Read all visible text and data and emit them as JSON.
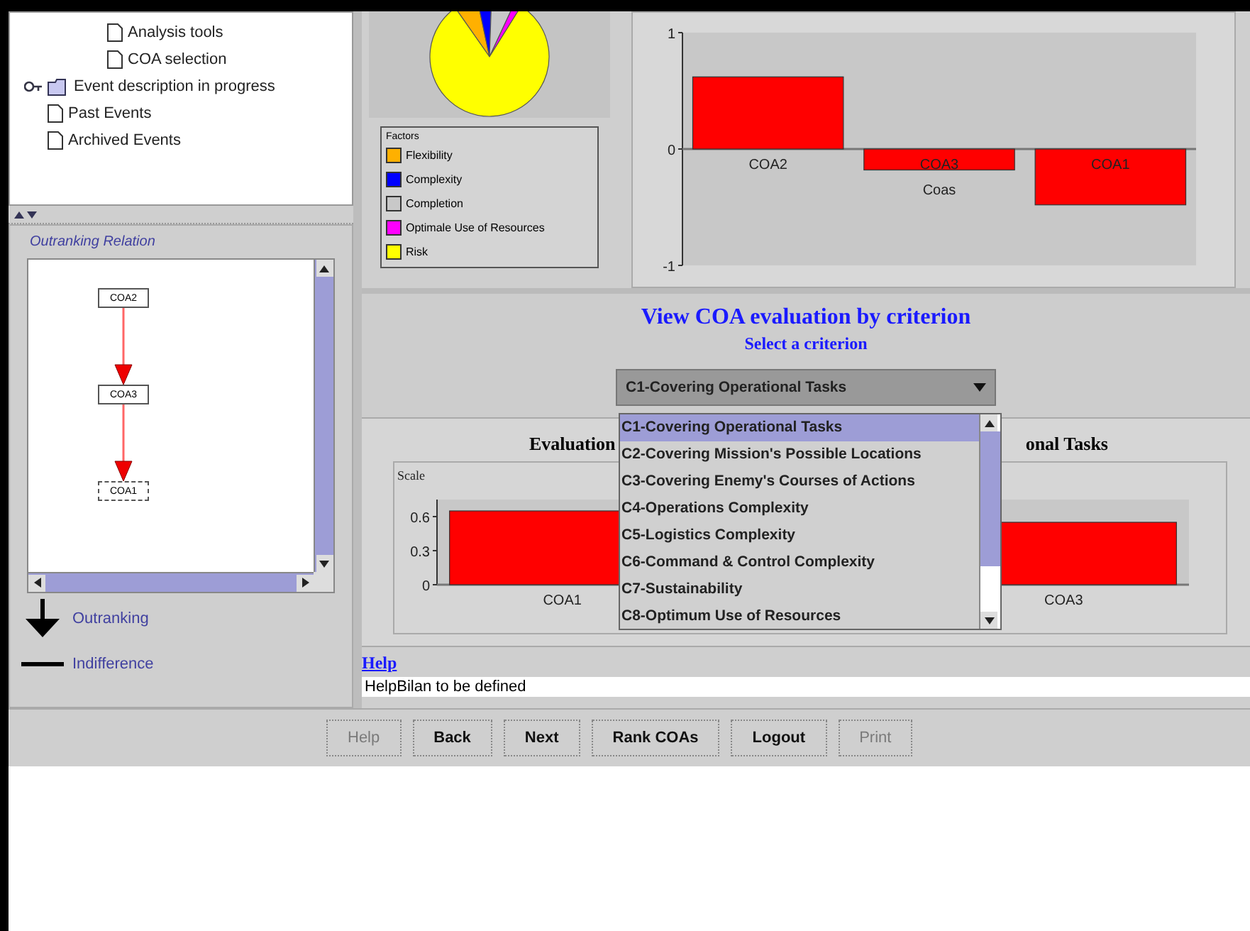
{
  "tree": {
    "items": [
      {
        "children": [
          {
            "label": "Analysis tools",
            "kind": "doc"
          },
          {
            "label": "COA selection",
            "kind": "doc"
          }
        ]
      },
      {
        "label": "Event description in progress",
        "kind": "folder"
      },
      {
        "label": "Past Events",
        "kind": "doc"
      },
      {
        "label": "Archived Events",
        "kind": "doc"
      }
    ]
  },
  "outranking": {
    "title": "Outranking Relation",
    "nodes": [
      "COA2",
      "COA3",
      "COA1"
    ],
    "legend": [
      {
        "kind": "arrow",
        "label": "Outranking"
      },
      {
        "kind": "line",
        "label": "Indifference"
      }
    ]
  },
  "factors": {
    "title": "Factors",
    "items": [
      {
        "label": "Flexibility",
        "color": "#ffb000"
      },
      {
        "label": "Complexity",
        "color": "#0000ff"
      },
      {
        "label": "Completion",
        "color": "#c8c8c8"
      },
      {
        "label": "Optimale Use of Resources",
        "color": "#ff00ff"
      },
      {
        "label": "Risk",
        "color": "#ffff00"
      }
    ]
  },
  "ranking_chart": {
    "chart_data": {
      "type": "bar",
      "xlabel": "Coas",
      "categories": [
        "COA2",
        "COA3",
        "COA1"
      ],
      "series": [
        {
          "color": "#ff0000",
          "values": [
            0.62,
            -0.18,
            -0.48
          ]
        }
      ],
      "ylim": [
        -1,
        1
      ],
      "yticks": [
        -1,
        0,
        1
      ]
    }
  },
  "criterion": {
    "title": "View COA evaluation by criterion",
    "subtitle": "Select a criterion",
    "dropdown": {
      "value": "C1-Covering Operational Tasks",
      "expanded": true,
      "options": [
        {
          "label": "C1-Covering Operational Tasks",
          "selected": true
        },
        {
          "label": "C2-Covering Mission's Possible Locations",
          "selected": false
        },
        {
          "label": "C3-Covering Enemy's Courses of Actions",
          "selected": false
        },
        {
          "label": "C4-Operations Complexity",
          "selected": false
        },
        {
          "label": "C5-Logistics Complexity",
          "selected": false
        },
        {
          "label": "C6-Command & Control Complexity",
          "selected": false
        },
        {
          "label": "C7-Sustainability",
          "selected": false
        },
        {
          "label": "C8-Optimum Use of Resources",
          "selected": false
        }
      ]
    },
    "chart_title_parts": [
      "Evaluation",
      "onal Tasks"
    ],
    "chart_data": {
      "type": "bar",
      "ylabel": "Scale",
      "categories": [
        "COA1",
        "COA3"
      ],
      "series": [
        {
          "color": "#ff0000",
          "values": [
            0.65,
            0.55
          ]
        }
      ],
      "ylim": [
        0,
        0.75
      ],
      "yticks": [
        0,
        0.3,
        0.6
      ]
    }
  },
  "help": {
    "title": "Help",
    "text": "HelpBilan to be defined"
  },
  "buttons": [
    {
      "label": "Help",
      "disabled": true
    },
    {
      "label": "Back",
      "disabled": false
    },
    {
      "label": "Next",
      "disabled": false
    },
    {
      "label": "Rank COAs",
      "disabled": false
    },
    {
      "label": "Logout",
      "disabled": false
    },
    {
      "label": "Print",
      "disabled": true
    }
  ]
}
